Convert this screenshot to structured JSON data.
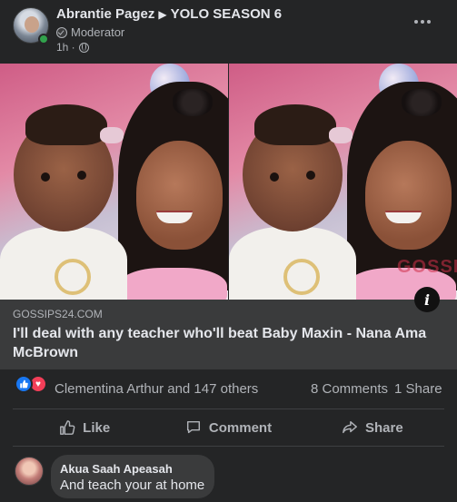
{
  "post": {
    "author": "Abrantie Pagez",
    "group": "YOLO SEASON 6",
    "role": "Moderator",
    "time": "1h ·"
  },
  "image": {
    "watermark": "GOSSIPS"
  },
  "link": {
    "domain": "GOSSIPS24.COM",
    "title": "I'll deal with any teacher who'll beat Baby Maxin - Nana Ama McBrown",
    "info_symbol": "i"
  },
  "stats": {
    "reactors": "Clementina Arthur and 147 others",
    "comments": "8 Comments",
    "shares": "1 Share"
  },
  "actions": {
    "like": "Like",
    "comment": "Comment",
    "share": "Share"
  },
  "comment": {
    "author": "Akua Saah Apeasah",
    "text": "And teach your at home"
  },
  "colors": {
    "background": "#242526",
    "link_preview": "#3a3b3c",
    "like_blue": "#1877f2",
    "love_red": "#f33e58",
    "online_green": "#31a24c"
  }
}
